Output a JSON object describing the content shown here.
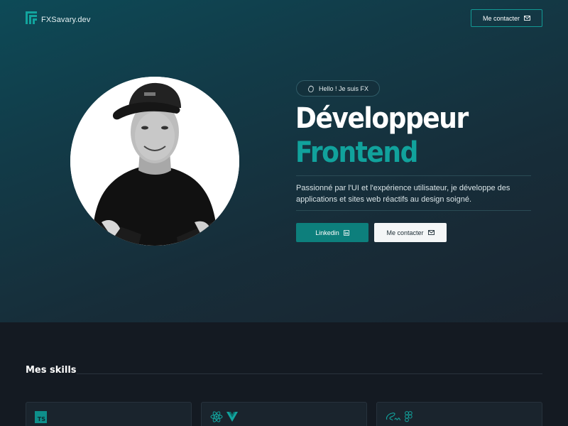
{
  "header": {
    "logo_text": "FXSavary.dev",
    "contact_label": "Me contacter"
  },
  "hero": {
    "badge": "Hello ! Je suis FX",
    "title_line1": "Développeur",
    "title_line2": "Frontend",
    "tagline": "Passionné par l'UI et l'expérience utilisateur, je développe des applications et sites web réactifs au design soigné.",
    "linkedin_label": "Linkedin",
    "contact_label": "Me contacter"
  },
  "skills": {
    "title": "Mes skills",
    "cards": [
      {
        "icons": [
          "typescript-icon"
        ],
        "ts_label": "TS"
      },
      {
        "icons": [
          "react-icon",
          "vue-icon"
        ]
      },
      {
        "icons": [
          "sass-icon",
          "figma-icon"
        ]
      }
    ]
  },
  "colors": {
    "accent": "#11a29c",
    "button_primary": "#0d7f7c",
    "background_dark": "#141a22",
    "card_bg": "#1a242d"
  }
}
